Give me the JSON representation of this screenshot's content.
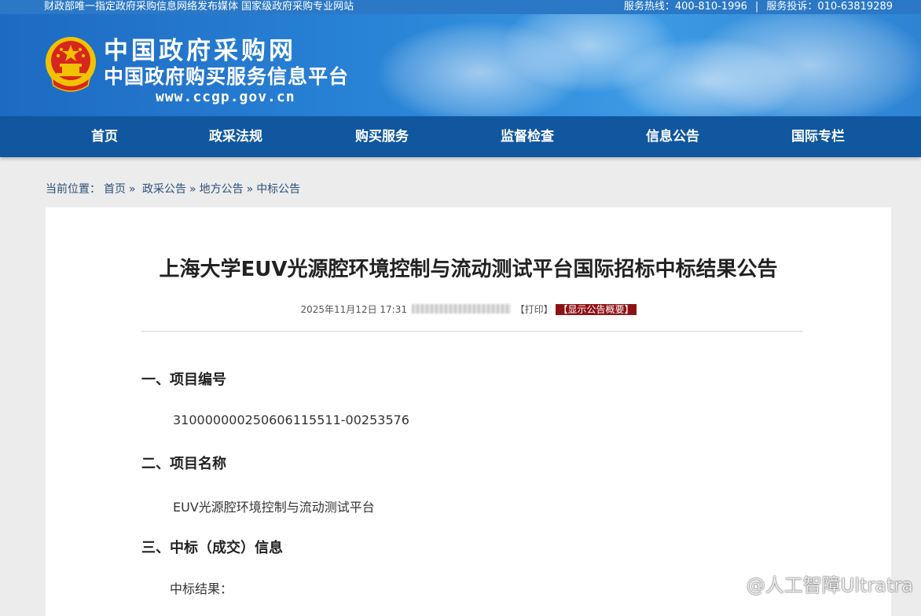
{
  "topbar": {
    "left_text": "财政部唯一指定政府采购信息网络发布媒体 国家级政府采购专业网站",
    "hotline": "服务热线：400-810-1996",
    "separator": "|",
    "complaint": "服务投诉：010-63819289"
  },
  "brand": {
    "title": "中国政府采购网",
    "subtitle": "中国政府购买服务信息平台",
    "url": "www.ccgp.gov.cn",
    "emblem_icon": "national-emblem-icon"
  },
  "nav": {
    "items": [
      {
        "label": "首页"
      },
      {
        "label": "政采法规"
      },
      {
        "label": "购买服务"
      },
      {
        "label": "监督检查"
      },
      {
        "label": "信息公告"
      },
      {
        "label": "国际专栏"
      }
    ]
  },
  "breadcrumb": {
    "prefix": "当前位置：",
    "items": [
      "首页",
      "政采公告",
      "地方公告",
      "中标公告"
    ],
    "separator": "»"
  },
  "article": {
    "title": "上海大学EUV光源腔环境控制与流动测试平台国际招标中标结果公告",
    "datetime": "2025年11月12日 17:31",
    "print_label": "【打印】",
    "summary_label": "【显示公告概要】",
    "sections": [
      {
        "heading": "一、项目编号",
        "text": "310000000250606115511-00253576"
      },
      {
        "heading": "二、项目名称",
        "text": "EUV光源腔环境控制与流动测试平台"
      },
      {
        "heading": "三、中标（成交）信息",
        "text": "中标结果："
      }
    ]
  },
  "watermark": {
    "text": "@人工智障Ultratra",
    "icon": "weibo-icon"
  },
  "colors": {
    "topbar": "#2b78c7",
    "nav": "#10579f",
    "summary_badge": "#8e1214"
  }
}
